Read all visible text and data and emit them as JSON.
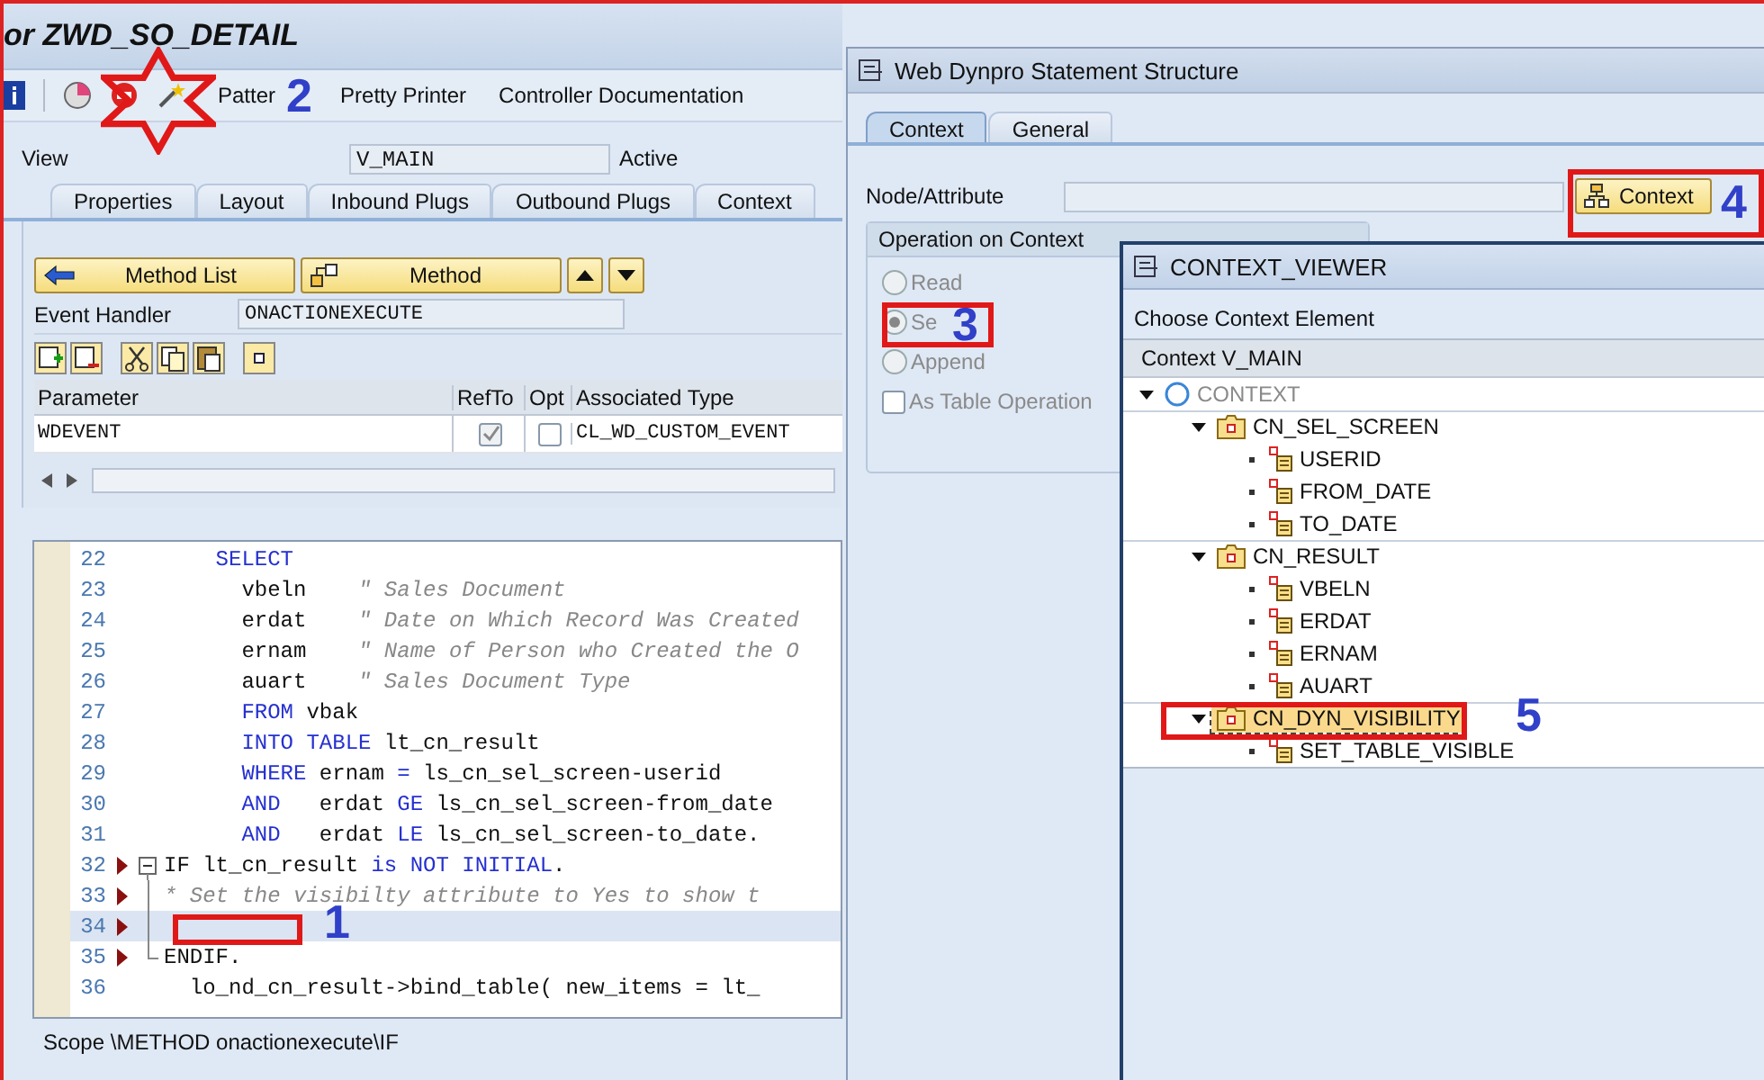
{
  "window": {
    "title": "or ZWD_SO_DETAIL"
  },
  "toolbar": {
    "items": [
      "Patter",
      "Pretty Printer",
      "Controller Documentation"
    ]
  },
  "view": {
    "label": "View",
    "value": "V_MAIN",
    "status": "Active"
  },
  "tabs": [
    {
      "label": "Properties",
      "selected": false
    },
    {
      "label": "Layout",
      "selected": false
    },
    {
      "label": "Inbound Plugs",
      "selected": false
    },
    {
      "label": "Outbound Plugs",
      "selected": false
    },
    {
      "label": "Context",
      "selected": false
    }
  ],
  "method_buttons": {
    "list": "Method List",
    "method": "Method"
  },
  "event_handler": {
    "label": "Event Handler",
    "value": "ONACTIONEXECUTE"
  },
  "parameters": {
    "columns": [
      "Parameter",
      "RefTo",
      "Opt",
      "Associated Type"
    ],
    "rows": [
      {
        "parameter": "WDEVENT",
        "refto": true,
        "opt": false,
        "type": "CL_WD_CUSTOM_EVENT"
      }
    ]
  },
  "code": [
    {
      "number": "22",
      "marker": false,
      "selected": false,
      "segments": [
        {
          "kind": "kw",
          "text": "    SELECT"
        }
      ]
    },
    {
      "number": "23",
      "marker": false,
      "selected": false,
      "segments": [
        {
          "kind": "text",
          "text": "      vbeln    "
        },
        {
          "kind": "comment",
          "text": "\" Sales Document"
        }
      ]
    },
    {
      "number": "24",
      "marker": false,
      "selected": false,
      "segments": [
        {
          "kind": "text",
          "text": "      erdat    "
        },
        {
          "kind": "comment",
          "text": "\" Date on Which Record Was Created"
        }
      ]
    },
    {
      "number": "25",
      "marker": false,
      "selected": false,
      "segments": [
        {
          "kind": "text",
          "text": "      ernam    "
        },
        {
          "kind": "comment",
          "text": "\" Name of Person who Created the O"
        }
      ]
    },
    {
      "number": "26",
      "marker": false,
      "selected": false,
      "segments": [
        {
          "kind": "text",
          "text": "      auart    "
        },
        {
          "kind": "comment",
          "text": "\" Sales Document Type"
        }
      ]
    },
    {
      "number": "27",
      "marker": false,
      "selected": false,
      "segments": [
        {
          "kind": "kw",
          "text": "      FROM"
        },
        {
          "kind": "text",
          "text": " vbak"
        }
      ]
    },
    {
      "number": "28",
      "marker": false,
      "selected": false,
      "segments": [
        {
          "kind": "kw",
          "text": "      INTO TABLE"
        },
        {
          "kind": "text",
          "text": " lt_cn_result"
        }
      ]
    },
    {
      "number": "29",
      "marker": false,
      "selected": false,
      "segments": [
        {
          "kind": "kw",
          "text": "      WHERE"
        },
        {
          "kind": "text",
          "text": " ernam "
        },
        {
          "kind": "kw",
          "text": "="
        },
        {
          "kind": "text",
          "text": " ls_cn_sel_screen-userid"
        }
      ]
    },
    {
      "number": "30",
      "marker": false,
      "selected": false,
      "segments": [
        {
          "kind": "kw",
          "text": "      AND"
        },
        {
          "kind": "text",
          "text": "   erdat "
        },
        {
          "kind": "kw",
          "text": "GE"
        },
        {
          "kind": "text",
          "text": " ls_cn_sel_screen-from_date"
        }
      ]
    },
    {
      "number": "31",
      "marker": false,
      "selected": false,
      "segments": [
        {
          "kind": "kw",
          "text": "      AND"
        },
        {
          "kind": "text",
          "text": "   erdat "
        },
        {
          "kind": "kw",
          "text": "LE"
        },
        {
          "kind": "text",
          "text": " ls_cn_sel_screen-to_date."
        }
      ]
    },
    {
      "number": "32",
      "marker": true,
      "fold_box": true,
      "selected": false,
      "segments": [
        {
          "kind": "text",
          "text": "IF lt_cn_result "
        },
        {
          "kind": "kw",
          "text": "is NOT INITIAL"
        },
        {
          "kind": "text",
          "text": "."
        }
      ]
    },
    {
      "number": "33",
      "marker": true,
      "fold_line": true,
      "selected": false,
      "segments": [
        {
          "kind": "comment",
          "text": "* Set the visibilty attribute to Yes to show t"
        }
      ]
    },
    {
      "number": "34",
      "marker": true,
      "fold_line": true,
      "selected": true
    },
    {
      "number": "35",
      "marker": true,
      "fold_end": true,
      "selected": false,
      "segments": [
        {
          "kind": "text",
          "text": "ENDIF."
        }
      ]
    },
    {
      "number": "36",
      "marker": false,
      "selected": false,
      "segments": [
        {
          "kind": "text",
          "text": "  lo_nd_cn_result->bind_table( new_items = lt_"
        }
      ]
    }
  ],
  "status_bar": "Scope \\METHOD onactionexecute\\IF",
  "statement_dialog": {
    "title": "Web Dynpro Statement Structure",
    "tabs": [
      {
        "label": "Context",
        "selected": true
      },
      {
        "label": "General",
        "selected": false
      }
    ],
    "node_label": "Node/Attribute",
    "context_button": "Context",
    "group_title": "Operation on Context",
    "options": [
      {
        "kind": "radio",
        "label": "Read",
        "selected": false,
        "disabled": true
      },
      {
        "kind": "radio",
        "label": "Se",
        "selected": true,
        "disabled": true
      },
      {
        "kind": "radio",
        "label": "Append",
        "selected": false,
        "disabled": true
      },
      {
        "kind": "checkbox",
        "label": "As Table Operation",
        "checked": false,
        "disabled": true
      }
    ]
  },
  "context_viewer": {
    "title": "CONTEXT_VIEWER",
    "prompt": "Choose Context Element",
    "header": "Context V_MAIN",
    "tree": [
      {
        "kind": "root",
        "label": "CONTEXT",
        "expanded": true,
        "selected": false,
        "children": [
          {
            "kind": "node",
            "label": "CN_SEL_SCREEN",
            "expanded": true,
            "selected": false,
            "children": [
              {
                "kind": "attribute",
                "label": "USERID",
                "selected": false
              },
              {
                "kind": "attribute",
                "label": "FROM_DATE",
                "selected": false
              },
              {
                "kind": "attribute",
                "label": "TO_DATE",
                "selected": false
              }
            ]
          },
          {
            "kind": "node",
            "label": "CN_RESULT",
            "expanded": true,
            "selected": false,
            "children": [
              {
                "kind": "attribute",
                "label": "VBELN",
                "selected": false
              },
              {
                "kind": "attribute",
                "label": "ERDAT",
                "selected": false
              },
              {
                "kind": "attribute",
                "label": "ERNAM",
                "selected": false
              },
              {
                "kind": "attribute",
                "label": "AUART",
                "selected": false
              }
            ]
          },
          {
            "kind": "node",
            "label": "CN_DYN_VISIBILITY",
            "expanded": true,
            "selected": true,
            "children": [
              {
                "kind": "attribute",
                "label": "SET_TABLE_VISIBLE",
                "selected": false
              }
            ]
          }
        ]
      }
    ]
  },
  "annotations": [
    {
      "kind": "star",
      "label": "2"
    },
    {
      "kind": "frame",
      "label": "1"
    },
    {
      "kind": "frame",
      "label": "3"
    },
    {
      "kind": "frame",
      "label": "4"
    },
    {
      "kind": "frame",
      "label": "5"
    }
  ]
}
